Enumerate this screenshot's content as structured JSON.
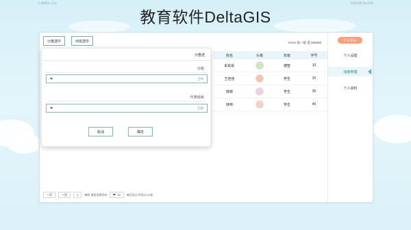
{
  "topbar": {
    "left": "与 教育局 | 社交",
    "right": "系统设置 退出系统"
  },
  "title": "教育软件DeltaGIS",
  "toolbar": {
    "btn1": "沙盘选中",
    "btn2": "出班选中"
  },
  "info_text": "0/101 班一级 选 888888",
  "table": {
    "headers": [
      "姓名",
      "头像",
      "年级",
      "学号"
    ],
    "rows": [
      {
        "name": "彩彩彩",
        "cls": "德智",
        "no": "10",
        "avatar_color": "#c9e9c2"
      },
      {
        "name": "王佳佳",
        "cls": "学生",
        "no": "20",
        "avatar_color": "#f6c5b0"
      },
      {
        "name": "菲菲",
        "cls": "学生",
        "no": "30",
        "avatar_color": "#f3d0d8"
      },
      {
        "name": "林林",
        "cls": "学生",
        "no": "40",
        "avatar_color": "#f2d3c2"
      }
    ]
  },
  "sidebar": {
    "head": "个人中心",
    "items": [
      {
        "label": "个人设置",
        "active": false
      },
      {
        "label": "班级管理",
        "active": true
      },
      {
        "label": "个人资料",
        "active": false
      }
    ]
  },
  "pager": {
    "prev": "一页",
    "next": "一页",
    "page": "1",
    "info1": "跳转 请您选择页码",
    "size": "20",
    "info2": "每页显示/共显示/15条"
  },
  "modal": {
    "title": "沙盘选",
    "field1_label": "分组:",
    "field1_placeholder": "全体",
    "field2_label": "代表班级:",
    "field2_placeholder": "全部",
    "confirm": "确定",
    "cancel": "取消"
  }
}
